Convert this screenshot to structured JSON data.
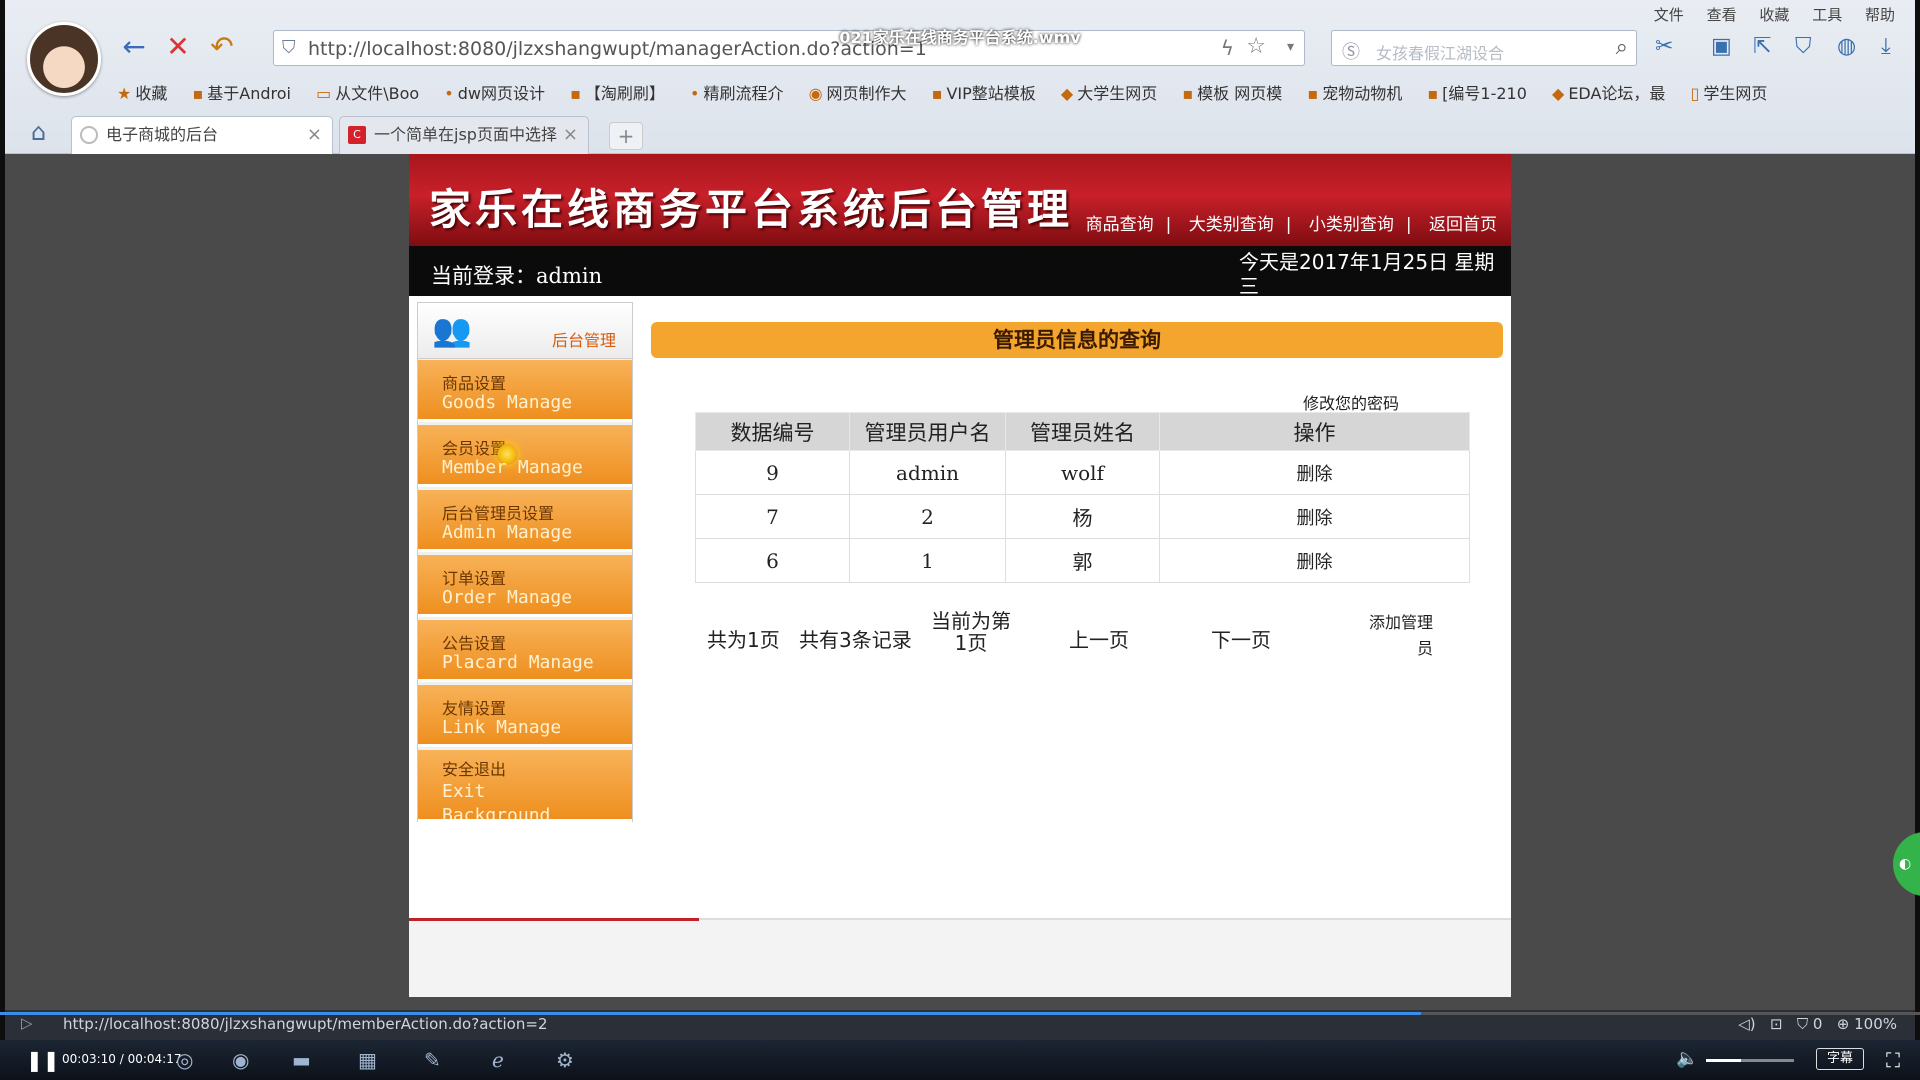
{
  "video": {
    "title": "021家乐在线商务平台系统.wmv"
  },
  "browser": {
    "address": "http://localhost:8080/jlzxshangwupt/managerAction.do?action=1",
    "search_placeholder": "女孩春假江湖设合",
    "menu": [
      "文件",
      "查看",
      "收藏",
      "工具",
      "帮助"
    ],
    "bookmarks": [
      "收藏",
      "基于Androi",
      "从文件\\Boo",
      "dw网页设计",
      "【淘刷刷】",
      "精刷流程介",
      "网页制作大",
      "VIP整站模板",
      "大学生网页",
      "模板 网页模",
      "宠物动物机",
      "[编号1-210",
      "EDA论坛，最",
      "学生网页"
    ],
    "tabs": [
      {
        "label": "电子商城的后台",
        "active": true
      },
      {
        "label": "一个简单在jsp页面中选择",
        "active": false
      }
    ]
  },
  "site": {
    "banner_title": "家乐在线商务平台系统后台管理",
    "nav": [
      "商品查询",
      "大类别查询",
      "小类别查询",
      "返回首页"
    ],
    "login_label": "当前登录：",
    "login_user": "admin",
    "date_text": "今天是2017年1月25日 星期三"
  },
  "sidebar": {
    "header": "后台管理",
    "items": [
      {
        "cn": "商品设置",
        "en": "Goods Manage"
      },
      {
        "cn": "会员设置",
        "en": "Member Manage"
      },
      {
        "cn": "后台管理员设置",
        "en": "Admin Manage"
      },
      {
        "cn": "订单设置",
        "en": "Order Manage"
      },
      {
        "cn": "公告设置",
        "en": "Placard Manage"
      },
      {
        "cn": "友情设置",
        "en": "Link Manage"
      },
      {
        "cn": "安全退出",
        "en": "Exit Background"
      }
    ]
  },
  "content": {
    "title": "管理员信息的查询",
    "change_password": "修改您的密码",
    "columns": [
      "数据编号",
      "管理员用户名",
      "管理员姓名",
      "操作"
    ],
    "rows": [
      {
        "id": "9",
        "username": "admin",
        "name": "wolf",
        "op": "删除"
      },
      {
        "id": "7",
        "username": "2",
        "name": "杨",
        "op": "删除"
      },
      {
        "id": "6",
        "username": "1",
        "name": "郭",
        "op": "删除"
      }
    ],
    "pager": {
      "total_pages": "共为1页",
      "total_records": "共有3条记录",
      "current": "当前为第1页",
      "prev": "上一页",
      "next": "下一页",
      "add_admin": "添加管理员"
    }
  },
  "status": {
    "url": "http://localhost:8080/jlzxshangwupt/memberAction.do?action=2",
    "zoom": "100%",
    "count": "0"
  },
  "player": {
    "time": "00:03:10 / 00:04:17",
    "progress": 0.74,
    "volume": 0.4,
    "caption_button": "字幕"
  },
  "colors": {
    "banner": "#c8202a",
    "accent": "#f4a52d",
    "sidebar_item": "#ee8f1f"
  }
}
